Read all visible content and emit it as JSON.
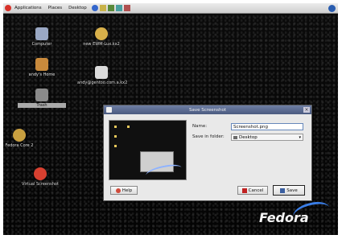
{
  "top_panel": {
    "menus": [
      "Applications",
      "Places",
      "Desktop"
    ]
  },
  "desktop_icons": [
    {
      "name": "computer",
      "label": "Computer",
      "icon": "computer-icon"
    },
    {
      "name": "home",
      "label": "andy's Home",
      "icon": "home-icon"
    },
    {
      "name": "trash",
      "label": "Trash",
      "icon": "trash-icon"
    },
    {
      "name": "shortcut-1",
      "label": "new EWM-Lux.kx2",
      "icon": "archive-icon"
    },
    {
      "name": "shortcut-2",
      "label": "andy@gentoo.com.a.kx2",
      "icon": "document-icon"
    },
    {
      "name": "shortcut-3",
      "label": "Fedora Core 2",
      "icon": "disc-icon"
    },
    {
      "name": "shortcut-4",
      "label": "Virtual Screenshot",
      "icon": "screenshot-icon"
    }
  ],
  "dialog": {
    "title": "Save Screenshot",
    "name_label": "Name:",
    "name_value": "Screenshot.png",
    "folder_label": "Save in folder:",
    "folder_value": "Desktop",
    "help_label": "Help",
    "cancel_label": "Cancel",
    "save_label": "Save"
  },
  "branding": {
    "logo_text": "Fedora"
  },
  "colors": {
    "accent": "#3a7ee8",
    "title_bar": "#4a5a80"
  }
}
